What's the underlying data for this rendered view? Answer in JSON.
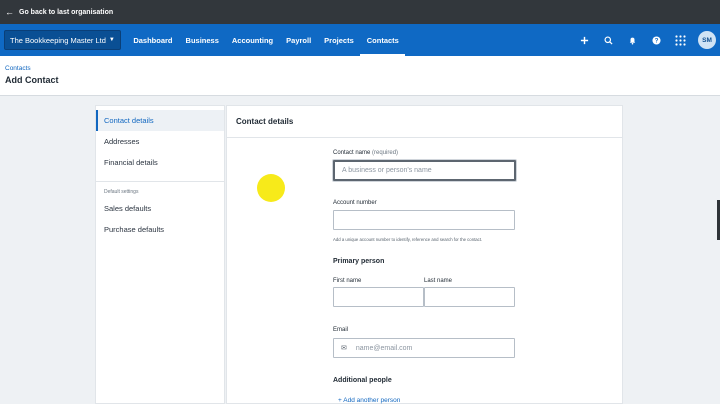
{
  "topbar": {
    "back_icon": "arrow-left-icon",
    "back_label": "Go back to last organisation"
  },
  "nav": {
    "org_name": "The Bookkeeping Master Ltd",
    "links": [
      {
        "label": "Dashboard"
      },
      {
        "label": "Business"
      },
      {
        "label": "Accounting"
      },
      {
        "label": "Payroll"
      },
      {
        "label": "Projects"
      },
      {
        "label": "Contacts",
        "active": true
      }
    ],
    "icons": [
      "plus-icon",
      "search-icon",
      "bell-icon",
      "help-icon",
      "apps-grid-icon"
    ],
    "avatar_initials": "SM"
  },
  "header": {
    "breadcrumb": "Contacts",
    "title": "Add Contact"
  },
  "sidebar": {
    "items": [
      {
        "label": "Contact details",
        "active": true
      },
      {
        "label": "Addresses"
      },
      {
        "label": "Financial details"
      }
    ],
    "defaults_heading": "Default settings",
    "default_items": [
      {
        "label": "Sales defaults"
      },
      {
        "label": "Purchase defaults"
      }
    ]
  },
  "form": {
    "title": "Contact details",
    "contact_name": {
      "label": "Contact name",
      "required": "(required)",
      "placeholder": "A business or person's name",
      "value": ""
    },
    "account_number": {
      "label": "Account number",
      "value": "",
      "help": "Add a unique account number to identify, reference and search for the contact."
    },
    "primary_person": {
      "heading": "Primary person",
      "first_name": {
        "label": "First name",
        "value": ""
      },
      "last_name": {
        "label": "Last name",
        "value": ""
      }
    },
    "email": {
      "label": "Email",
      "placeholder": "name@email.com",
      "icon": "envelope-icon",
      "value": ""
    },
    "additional_people": {
      "heading": "Additional people",
      "add_link": "+ Add another person"
    }
  },
  "colors": {
    "brand_blue": "#0f69c4",
    "topbar": "#32373c",
    "link": "#1167c0",
    "cursor_highlight": "#f7ea1a"
  }
}
